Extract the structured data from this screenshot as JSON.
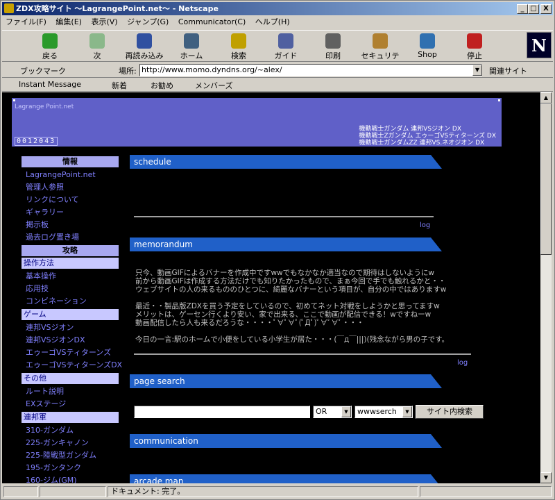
{
  "window": {
    "title": "ZDX攻略サイト 〜LagrangePoint.net〜 - Netscape",
    "min": "_",
    "max": "□",
    "close": "X"
  },
  "menu": [
    "ファイル(F)",
    "編集(E)",
    "表示(V)",
    "ジャンプ(G)",
    "Communicator(C)",
    "ヘルプ(H)"
  ],
  "toolbar": [
    {
      "label": "戻る",
      "icon": "back-icon",
      "color": "#2a9a2a"
    },
    {
      "label": "次",
      "icon": "forward-icon",
      "color": "#8ab88a"
    },
    {
      "label": "再読み込み",
      "icon": "reload-icon",
      "color": "#3050a0"
    },
    {
      "label": "ホーム",
      "icon": "home-icon",
      "color": "#406080"
    },
    {
      "label": "検索",
      "icon": "search-icon",
      "color": "#c0a000"
    },
    {
      "label": "ガイド",
      "icon": "guide-icon",
      "color": "#5060a0"
    },
    {
      "label": "印刷",
      "icon": "print-icon",
      "color": "#606060"
    },
    {
      "label": "セキュリティ",
      "icon": "lock-icon",
      "color": "#b08030"
    },
    {
      "label": "Shop",
      "icon": "shop-icon",
      "color": "#3070b0"
    },
    {
      "label": "停止",
      "icon": "stop-icon",
      "color": "#c02020"
    }
  ],
  "brand_logo": "N",
  "location": {
    "bookmark": "ブックマーク",
    "label": "場所:",
    "url": "http://www.momo.dyndns.org/~alex/",
    "related": "関連サイト"
  },
  "personal": [
    "Instant Message",
    "新着",
    "お勧め",
    "メンバーズ"
  ],
  "banner": {
    "site": "Lagrange Point.net",
    "counter": "0012043",
    "news": [
      "機動戦士ガンダム 連邦VSジオン DX",
      "機動戦士Zガンダム エゥーゴVSティターンズ DX",
      "機動戦士ガンダムZZ 連邦VS.ネオジオン DX"
    ]
  },
  "sidebar": [
    {
      "type": "head",
      "text": "情報"
    },
    {
      "type": "link",
      "text": "LagrangePoint.net"
    },
    {
      "type": "link",
      "text": "管理人参照"
    },
    {
      "type": "link",
      "text": "リンクについて"
    },
    {
      "type": "link",
      "text": "ギャラリー"
    },
    {
      "type": "link",
      "text": "掲示板"
    },
    {
      "type": "link",
      "text": "過去ログ置き場"
    },
    {
      "type": "head",
      "text": "攻略"
    },
    {
      "type": "sub",
      "text": "操作方法"
    },
    {
      "type": "link",
      "text": "基本操作"
    },
    {
      "type": "link",
      "text": "応用技"
    },
    {
      "type": "link",
      "text": "コンビネーション"
    },
    {
      "type": "sub",
      "text": "ゲーム"
    },
    {
      "type": "link",
      "text": "連邦VSジオン"
    },
    {
      "type": "link",
      "text": "連邦VSジオンDX"
    },
    {
      "type": "link",
      "text": "エゥーゴVSティターンズ"
    },
    {
      "type": "link",
      "text": "エゥーゴVSティターンズDX"
    },
    {
      "type": "sub",
      "text": "その他"
    },
    {
      "type": "link",
      "text": "ルート説明"
    },
    {
      "type": "link",
      "text": "EXステージ"
    },
    {
      "type": "sub",
      "text": "連邦軍"
    },
    {
      "type": "link",
      "text": "310-ガンダム"
    },
    {
      "type": "link",
      "text": "225-ガンキャノン"
    },
    {
      "type": "link",
      "text": "225-陸戦型ガンダム"
    },
    {
      "type": "link",
      "text": "195-ガンタンク"
    },
    {
      "type": "link",
      "text": "160-ジム(GM)"
    }
  ],
  "sections": {
    "schedule": "schedule",
    "memorandum": "memorandum",
    "page_search": "page search",
    "communication": "communication",
    "arcade": "arcade man"
  },
  "log_label": "log",
  "memo_paragraphs": [
    "只今、動画GIFによるバナーを作成中ですwwでもなかなか適当なので期待はしないようにw\n前から動画GIFは作成する方法だけでも知りたかったもので、まぁ今回で手でも触れるかと・・\nウェブサイトの人の来るもののひとつに、綺麗なバナーという項目が、自分の中ではありますw",
    "最近・・製品版ZDXを買う予定をしているので、初めてネット対戦をしようかと思ってますw\nメリットは、ゲーセン行くより安い、家で出来る、ここで動画が配信できる！wですねーw\n動画配信したら人も来るだろうな・・・・ﾟ∀ﾟ∀ﾟ(ﾟДﾟ)ﾟ∀ﾟ∀ﾟ・・・",
    "今日の一言:駅のホームで小便をしている小学生が居た・・・(￣д￣|||)(残念ながら男の子です。"
  ],
  "search": {
    "value": "",
    "op": "OR",
    "target": "wwwserch",
    "button": "サイト内検索"
  },
  "status": {
    "text": "ドキュメント: 完了。"
  }
}
